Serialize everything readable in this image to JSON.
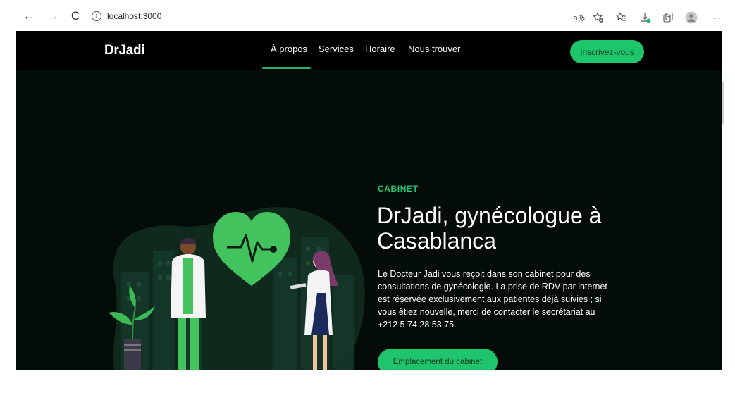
{
  "browser": {
    "url": "localhost:3000",
    "buttons": {
      "back": "←",
      "forward": "→",
      "reload": "C"
    },
    "toolbar_icons": [
      "read-aloud-icon",
      "favorite-add-icon",
      "favorites-icon",
      "downloads-icon",
      "collections-icon",
      "profile-icon",
      "more-icon"
    ],
    "read_aloud_glyph": "aあ",
    "more_glyph": "···"
  },
  "site": {
    "logo": "DrJadi",
    "nav": [
      {
        "label": "À propos",
        "active": true
      },
      {
        "label": "Services",
        "active": false
      },
      {
        "label": "Horaire",
        "active": false
      },
      {
        "label": "Nous trouver",
        "active": false
      }
    ],
    "cta": "Inscrivez-vous"
  },
  "hero": {
    "label": "CABINET",
    "title": "DrJadi, gynécologue à Casablanca",
    "description": "Le Docteur Jadi vous reçoit dans son cabinet pour des consultations de gynécologie. La prise de RDV par internet est réservée exclusivement aux patientes déjà suivies ; si vous êtiez nouvelle, merci de contacter le secrétariat au +212 5 74 28 53 75.",
    "button": "Emplacement du cabinet"
  },
  "colors": {
    "accent": "#1ec66b",
    "background": "#040c09",
    "nav": "#000000"
  }
}
